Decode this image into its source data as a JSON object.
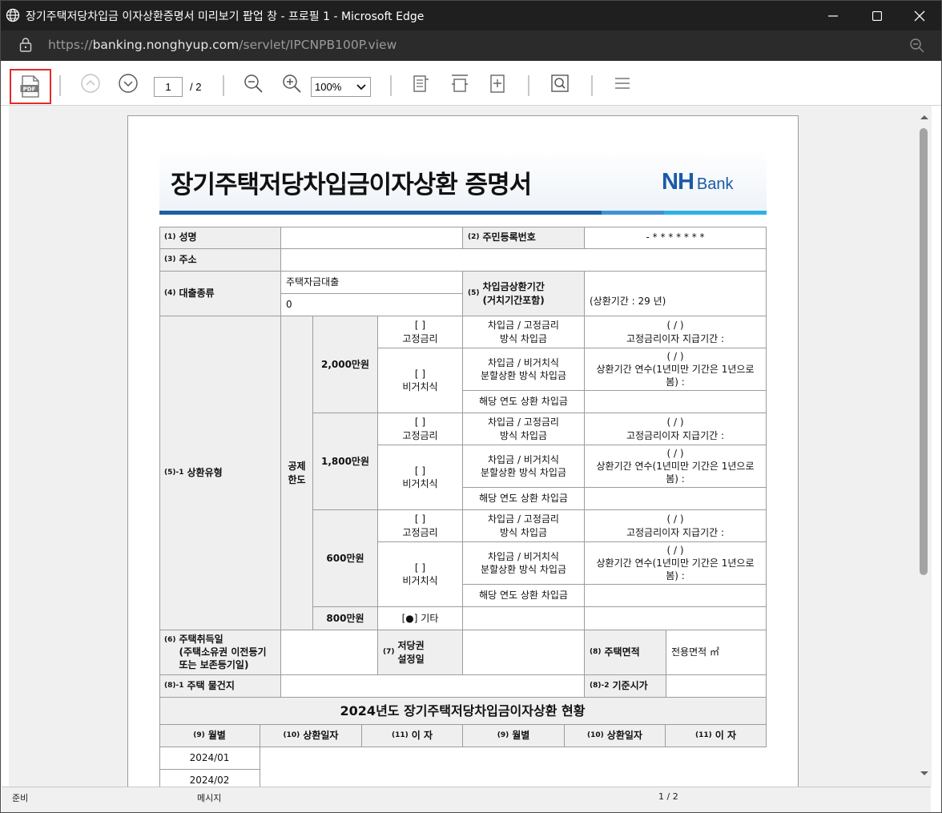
{
  "window": {
    "title": "장기주택저당차입금 이자상환증명서 미리보기 팝업 창 - 프로필 1 - Microsoft Edge"
  },
  "address": {
    "url_prefix": "https://",
    "url_host": "banking.nonghyup.com",
    "url_path": "/servlet/IPCNPB100P.view"
  },
  "toolbar": {
    "page_current": "1",
    "page_total": "/ 2",
    "zoom": "100%"
  },
  "status": {
    "left": "준비",
    "mid": "메시지",
    "right": "1 / 2"
  },
  "doc": {
    "title": "장기주택저당차입금이자상환 증명서",
    "logo_nh": "NH",
    "logo_bank": "Bank",
    "n1": "(1)",
    "l_name": "성명",
    "n2": "(2)",
    "l_rrn": "주민등록번호",
    "v_rrn": "- * * * * * * *",
    "n3": "(3)",
    "l_addr": "주소",
    "n4": "(4)",
    "l_loan": "대출종류",
    "v_loan1": "주택자금대출",
    "v_loan2": "0",
    "n5": "(5)",
    "l_period": "차입금상환기간\n(거치기간포함)",
    "v_period": "(상환기간 : 29  년)",
    "n51": "(5)-1",
    "l_type": "상환유형",
    "l_gongje": "공제\n한도",
    "limits": [
      "2,000만원",
      "1,800만원",
      "600만원",
      "800만원"
    ],
    "fixed": "[ ]\n고정금리",
    "nonperiod": "[ ]\n비거치식",
    "d_fixed": "차입금 / 고정금리\n방식 차입금",
    "d_nonperiod": "차입금 / 비거치식\n분할상환 방식 차입금",
    "d_year": "해당 연도 상환 차입금",
    "v_fixed": "( / )\n고정금리이자 지급기간 :",
    "v_nonperiod": "( / )\n상환기간 연수(1년미만 기간은 1년으로\n봄) :",
    "etc": "[●] 기타",
    "n6": "(6)",
    "l_acq": "주택취득일\n(주택소유권 이전등기\n또는 보존등기일)",
    "n7": "(7)",
    "l_mortgage": "저당권\n설정일",
    "n8": "(8)",
    "l_area": "주택면적",
    "v_area": "전용면적 ㎡",
    "n81": "(8)-1",
    "l_loc": "주택 물건지",
    "n82": "(8)-2",
    "l_base": "기준시가",
    "sec_title": "2024년도 장기주택저당차입금이자상환 현황",
    "cols": [
      {
        "n": "(9)",
        "l": "월별"
      },
      {
        "n": "(10)",
        "l": "상환일자"
      },
      {
        "n": "(11)",
        "l": "이 자"
      },
      {
        "n": "(9)",
        "l": "월별"
      },
      {
        "n": "(10)",
        "l": "상환일자"
      },
      {
        "n": "(11)",
        "l": "이 자"
      }
    ],
    "months": [
      "2024/01",
      "2024/02"
    ]
  }
}
